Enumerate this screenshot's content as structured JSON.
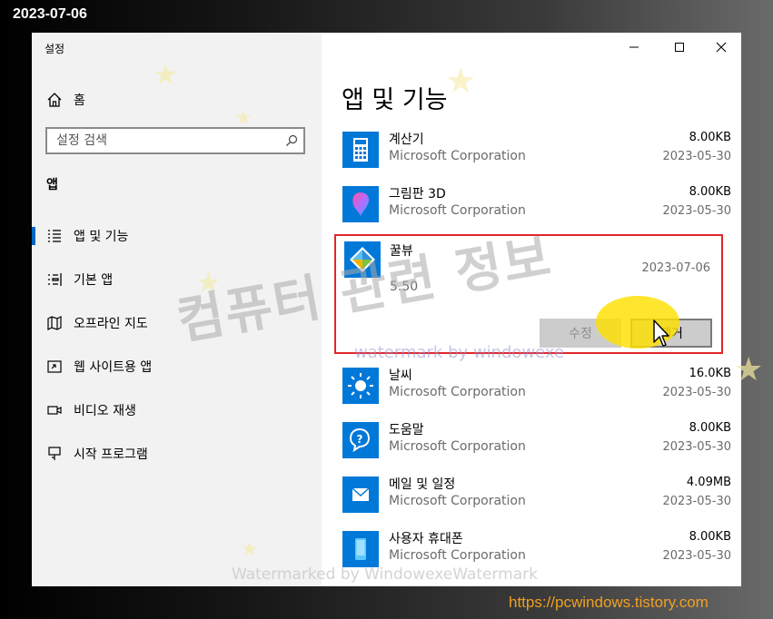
{
  "overlay": {
    "date_stamp": "2023-07-06",
    "site_url": "https://pcwindows.tistory.com",
    "watermark_main": "컴퓨터 관련 정보",
    "watermark_sub": "watermark by windowexe",
    "watermark_bottom": "Watermarked by WindowexeWatermark",
    "highlight_color": "#ffe100"
  },
  "window": {
    "title": "설정"
  },
  "sidebar": {
    "home_label": "홈",
    "search_placeholder": "설정 검색",
    "section_header": "앱",
    "items": [
      {
        "label": "앱 및 기능",
        "icon": "apps-features-icon",
        "active": true
      },
      {
        "label": "기본 앱",
        "icon": "default-apps-icon"
      },
      {
        "label": "오프라인 지도",
        "icon": "offline-maps-icon"
      },
      {
        "label": "웹 사이트용 앱",
        "icon": "apps-for-websites-icon"
      },
      {
        "label": "비디오 재생",
        "icon": "video-playback-icon"
      },
      {
        "label": "시작 프로그램",
        "icon": "startup-icon"
      }
    ]
  },
  "main": {
    "title": "앱 및 기능",
    "apps": [
      {
        "name": "계산기",
        "publisher": "Microsoft Corporation",
        "size": "8.00KB",
        "date": "2023-05-30",
        "icon": "calculator-icon"
      },
      {
        "name": "그림판 3D",
        "publisher": "Microsoft Corporation",
        "size": "8.00KB",
        "date": "2023-05-30",
        "icon": "paint3d-icon"
      }
    ],
    "selected_app": {
      "name": "꿀뷰",
      "date": "2023-07-06",
      "version": "5.50",
      "modify_label": "수정",
      "remove_label": "제거",
      "icon": "honeyview-icon"
    },
    "apps_after": [
      {
        "name": "날씨",
        "publisher": "Microsoft Corporation",
        "size": "16.0KB",
        "date": "2023-05-30",
        "icon": "weather-icon"
      },
      {
        "name": "도움말",
        "publisher": "Microsoft Corporation",
        "size": "8.00KB",
        "date": "2023-05-30",
        "icon": "get-help-icon"
      },
      {
        "name": "메일 및 일정",
        "publisher": "Microsoft Corporation",
        "size": "4.09MB",
        "date": "2023-05-30",
        "icon": "mail-calendar-icon"
      },
      {
        "name": "사용자 휴대폰",
        "publisher": "Microsoft Corporation",
        "size": "8.00KB",
        "date": "2023-05-30",
        "icon": "your-phone-icon"
      }
    ]
  },
  "colors": {
    "accent": "#0067c0",
    "app_tile": "#0078d7",
    "selected_border": "#e0262a"
  }
}
